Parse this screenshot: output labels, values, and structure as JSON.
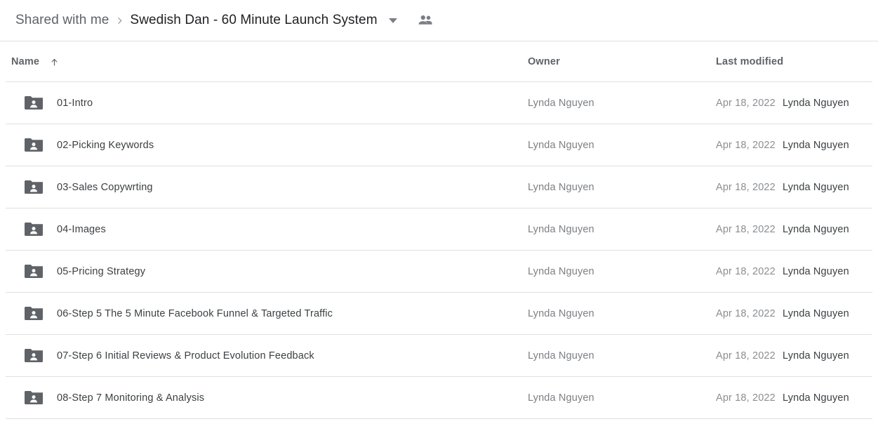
{
  "breadcrumb": {
    "parent_label": "Shared with me",
    "separator_icon": "chevron-right-icon",
    "current_label": "Swedish Dan - 60 Minute Launch System",
    "dropdown_icon": "chevron-down-icon",
    "people_icon": "people-icon"
  },
  "columns": {
    "name": "Name",
    "sort_icon": "arrow-up-icon",
    "owner": "Owner",
    "last_modified": "Last modified"
  },
  "colors": {
    "text_primary": "#3c4043",
    "text_secondary": "#5f6368",
    "text_muted": "#8b8e92",
    "divider": "#e0e0e0",
    "folder_icon": "#5f6368",
    "background": "#ffffff"
  },
  "rows": [
    {
      "icon": "shared-folder-icon",
      "name": "01-Intro",
      "owner": "Lynda Nguyen",
      "modified_date": "Apr 18, 2022",
      "modified_by": "Lynda Nguyen"
    },
    {
      "icon": "shared-folder-icon",
      "name": "02-Picking Keywords",
      "owner": "Lynda Nguyen",
      "modified_date": "Apr 18, 2022",
      "modified_by": "Lynda Nguyen"
    },
    {
      "icon": "shared-folder-icon",
      "name": "03-Sales Copywrting",
      "owner": "Lynda Nguyen",
      "modified_date": "Apr 18, 2022",
      "modified_by": "Lynda Nguyen"
    },
    {
      "icon": "shared-folder-icon",
      "name": "04-Images",
      "owner": "Lynda Nguyen",
      "modified_date": "Apr 18, 2022",
      "modified_by": "Lynda Nguyen"
    },
    {
      "icon": "shared-folder-icon",
      "name": "05-Pricing Strategy",
      "owner": "Lynda Nguyen",
      "modified_date": "Apr 18, 2022",
      "modified_by": "Lynda Nguyen"
    },
    {
      "icon": "shared-folder-icon",
      "name": "06-Step 5 The 5 Minute Facebook Funnel & Targeted Traffic",
      "owner": "Lynda Nguyen",
      "modified_date": "Apr 18, 2022",
      "modified_by": "Lynda Nguyen"
    },
    {
      "icon": "shared-folder-icon",
      "name": "07-Step 6 Initial Reviews & Product Evolution Feedback",
      "owner": "Lynda Nguyen",
      "modified_date": "Apr 18, 2022",
      "modified_by": "Lynda Nguyen"
    },
    {
      "icon": "shared-folder-icon",
      "name": "08-Step 7 Monitoring & Analysis",
      "owner": "Lynda Nguyen",
      "modified_date": "Apr 18, 2022",
      "modified_by": "Lynda Nguyen"
    }
  ]
}
